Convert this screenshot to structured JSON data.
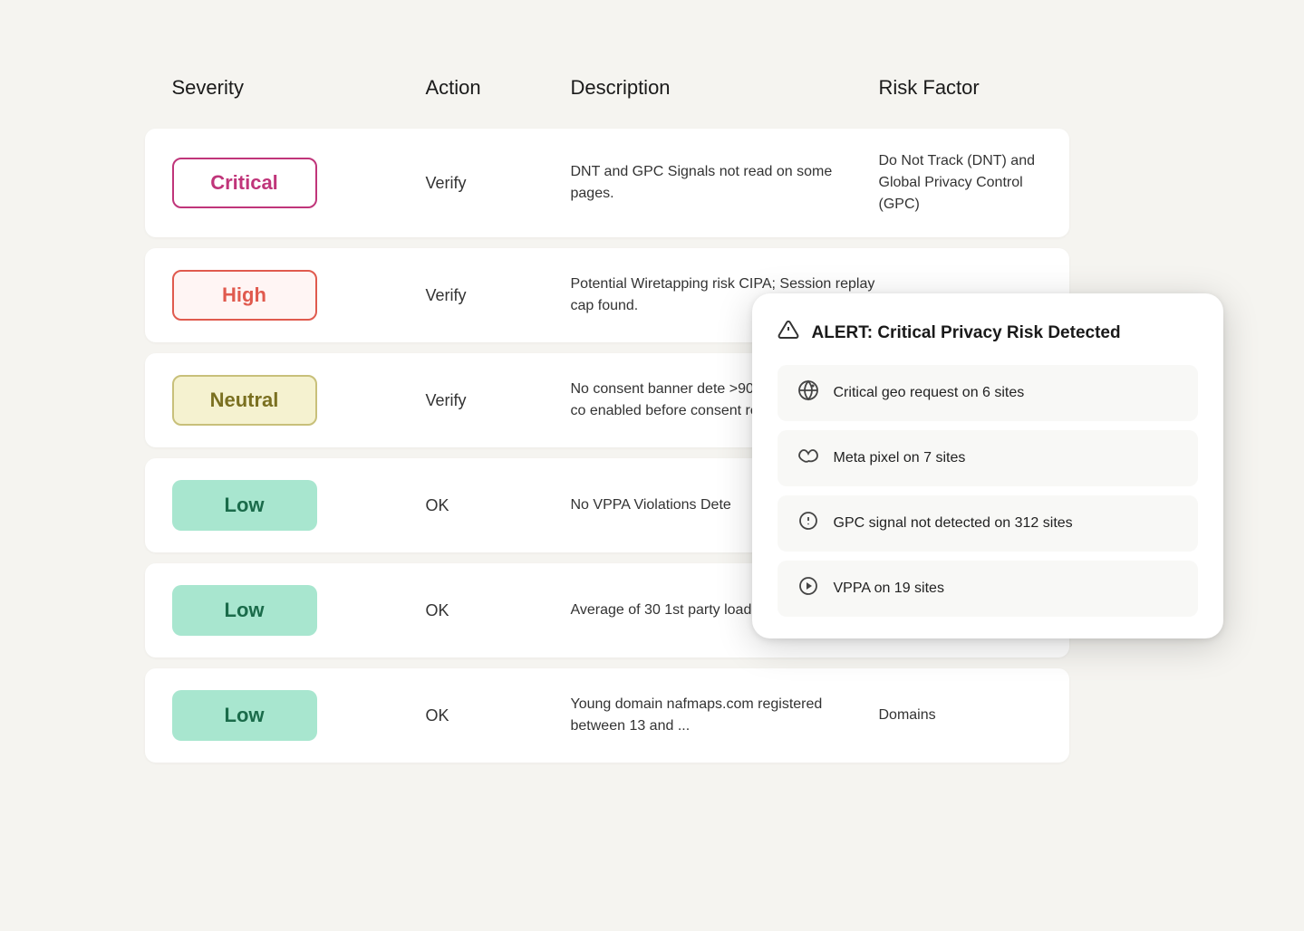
{
  "table": {
    "headers": {
      "severity": "Severity",
      "action": "Action",
      "description": "Description",
      "risk_factor": "Risk Factor"
    },
    "rows": [
      {
        "severity": "Critical",
        "severity_class": "critical",
        "action": "Verify",
        "description": "DNT and GPC Signals not read on some pages.",
        "risk_factor": "Do Not Track (DNT) and Global Privacy Control (GPC)"
      },
      {
        "severity": "High",
        "severity_class": "high",
        "action": "Verify",
        "description": "Potential Wiretapping risk CIPA; Session replay cap found.",
        "risk_factor": ""
      },
      {
        "severity": "Neutral",
        "severity_class": "neutral",
        "action": "Verify",
        "description": "No consent banner dete >90% of pages. Data co enabled before consent requested.",
        "risk_factor": ""
      },
      {
        "severity": "Low",
        "severity_class": "low",
        "action": "OK",
        "description": "No VPPA Violations Dete",
        "risk_factor": ""
      },
      {
        "severity": "Low",
        "severity_class": "low",
        "action": "OK",
        "description": "Average of 30 1st party loaded on each page.",
        "risk_factor": ""
      },
      {
        "severity": "Low",
        "severity_class": "low",
        "action": "OK",
        "description": "Young domain nafmaps.com registered between 13 and ...",
        "risk_factor": "Domains"
      }
    ]
  },
  "alert": {
    "title": "ALERT: Critical Privacy Risk Detected",
    "items": [
      {
        "icon_type": "geo",
        "text": "Critical geo request on 6 sites"
      },
      {
        "icon_type": "meta",
        "text": "Meta pixel on 7 sites"
      },
      {
        "icon_type": "gpc",
        "text": "GPC signal not detected on 312 sites"
      },
      {
        "icon_type": "vppa",
        "text": "VPPA on 19 sites"
      }
    ]
  }
}
